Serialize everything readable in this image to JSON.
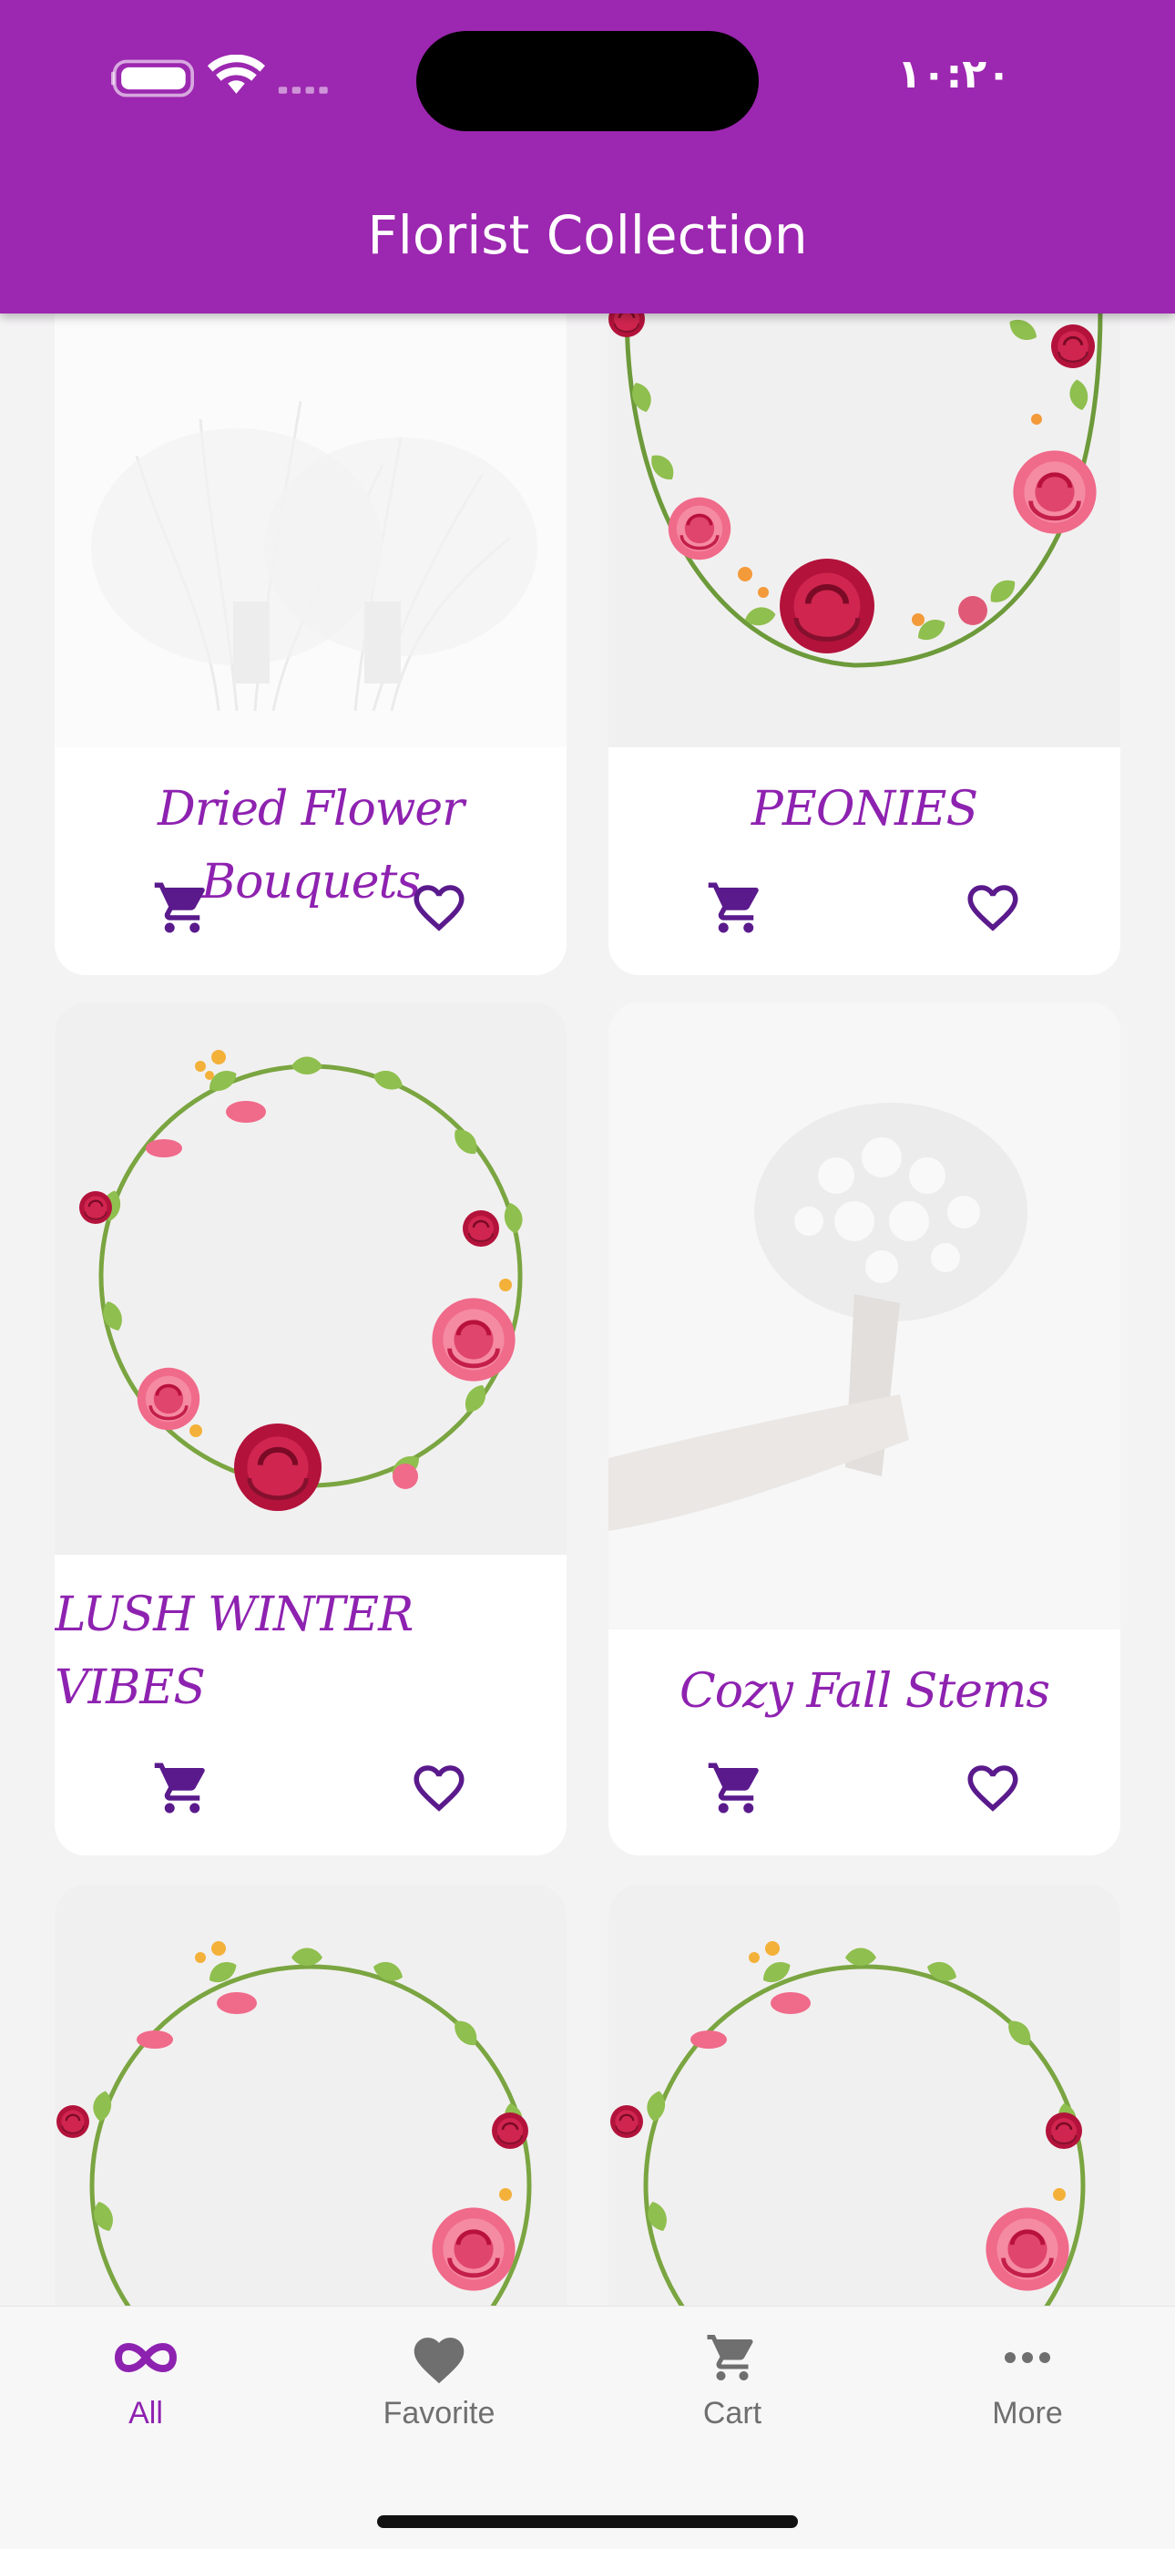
{
  "status_bar": {
    "time": "١٠:٢٠"
  },
  "app_bar": {
    "title": "Florist Collection"
  },
  "products": [
    {
      "name": "Dried Flower Bouquets",
      "image": "dried-bouquet-photo"
    },
    {
      "name": "PEONIES",
      "image": "watercolor-rose-wreath"
    },
    {
      "name": "LUSH WINTER VIBES",
      "image": "watercolor-floral-wreath"
    },
    {
      "name": "Cozy Fall Stems",
      "image": "babys-breath-bouquet-photo"
    },
    {
      "name": "",
      "image": "watercolor-floral-wreath"
    },
    {
      "name": "",
      "image": "watercolor-floral-wreath"
    }
  ],
  "card_icons": {
    "cart": "cart-icon",
    "favorite": "heart-outline-icon"
  },
  "bottom_nav": {
    "items": [
      {
        "label": "All",
        "icon": "infinity-icon",
        "active": true
      },
      {
        "label": "Favorite",
        "icon": "heart-filled-icon",
        "active": false
      },
      {
        "label": "Cart",
        "icon": "cart-icon",
        "active": false
      },
      {
        "label": "More",
        "icon": "more-dots-icon",
        "active": false
      }
    ]
  },
  "colors": {
    "primary": "#9c27b0",
    "accent": "#8e22b0",
    "icon_dark": "#5a1a8c"
  }
}
